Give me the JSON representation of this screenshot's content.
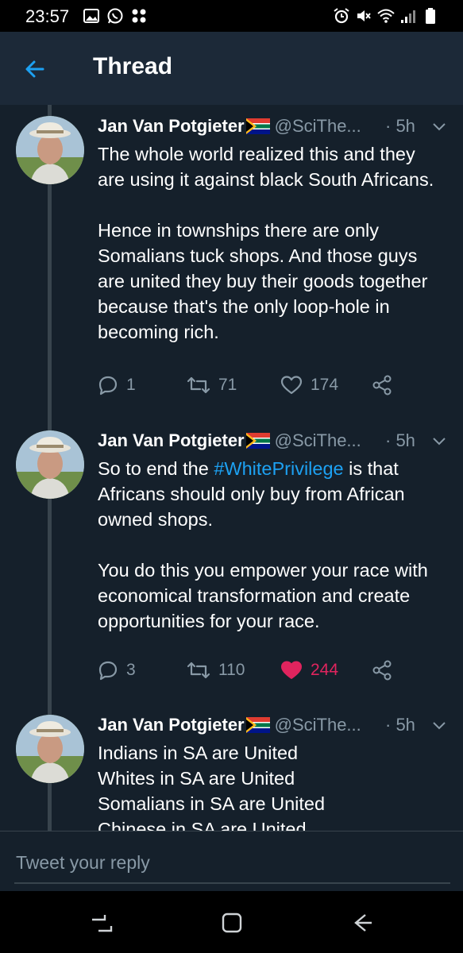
{
  "status_bar": {
    "time": "23:57",
    "left_icons": [
      "image-icon",
      "whatsapp-icon",
      "apps-icon"
    ],
    "right_icons": [
      "alarm-icon",
      "mute-icon",
      "wifi-icon",
      "signal-icon",
      "battery-icon"
    ]
  },
  "header": {
    "title": "Thread",
    "back_icon": "arrow-left-icon",
    "accent_color": "#1da1f2"
  },
  "tweets": [
    {
      "author": "Jan Van Potgieter",
      "flag": "south-africa-flag",
      "handle": "@SciThe...",
      "time": "· 5h",
      "body": "The whole world realized this and they are using it against black South Africans.\n\nHence in townships there are only Somalians tuck shops. And those guys are united they buy their goods together because that's the only loop-hole in becoming rich.",
      "replies": "1",
      "retweets": "71",
      "likes": "174",
      "liked": false
    },
    {
      "author": "Jan Van Potgieter",
      "flag": "south-africa-flag",
      "handle": "@SciThe...",
      "time": "· 5h",
      "body_before": "So to end the ",
      "hashtag": "#WhitePrivilege",
      "body_after": " is that Africans should only buy from African owned shops.\n\nYou do this you empower your race with economical transformation and create opportunities for your race.",
      "replies": "3",
      "retweets": "110",
      "likes": "244",
      "liked": true
    },
    {
      "author": "Jan Van Potgieter",
      "flag": "south-africa-flag",
      "handle": "@SciThe...",
      "time": "· 5h",
      "body": "Indians in SA are United\nWhites in SA are United\nSomalians in SA are United\nChinese in SA are United"
    }
  ],
  "compose": {
    "placeholder": "Tweet your reply"
  },
  "nav_bar": {
    "buttons": [
      "recent-apps-icon",
      "home-icon",
      "back-icon"
    ]
  },
  "colors": {
    "background": "#15202b",
    "header_background": "#1c2938",
    "secondary_text": "#8899a6",
    "like_active": "#e0245e",
    "hashtag": "#1da1f2"
  }
}
